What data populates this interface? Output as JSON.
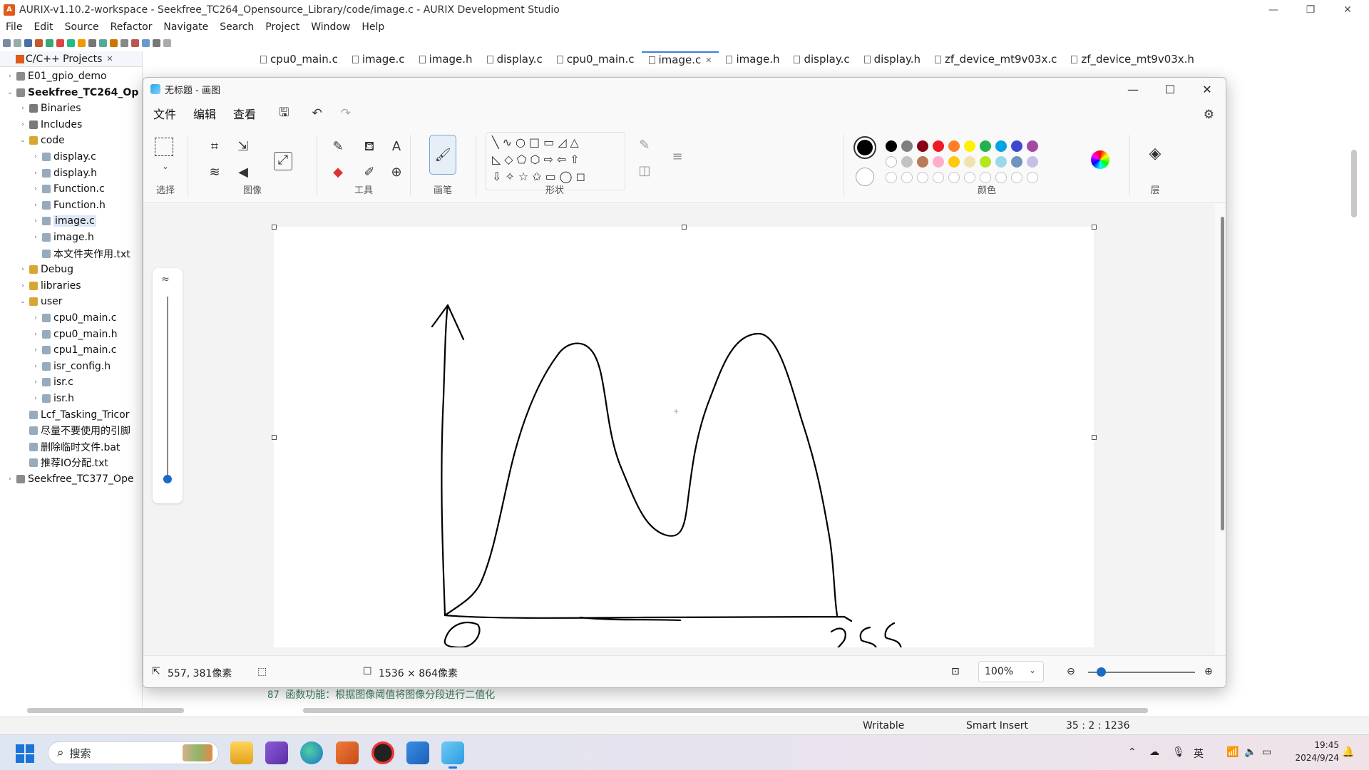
{
  "ide": {
    "title": "AURIX-v1.10.2-workspace - Seekfree_TC264_Opensource_Library/code/image.c - AURIX Development Studio",
    "menu": [
      "File",
      "Edit",
      "Source",
      "Refactor",
      "Navigate",
      "Search",
      "Project",
      "Window",
      "Help"
    ],
    "explorer_title": "C/C++ Projects",
    "tree": [
      {
        "label": "E01_gpio_demo",
        "indent": 0,
        "arrow": "›",
        "icon": "proj",
        "bold": false
      },
      {
        "label": "Seekfree_TC264_Op",
        "indent": 0,
        "arrow": "⌄",
        "icon": "proj",
        "bold": true
      },
      {
        "label": "Binaries",
        "indent": 1,
        "arrow": "›",
        "icon": "bin",
        "bold": false
      },
      {
        "label": "Includes",
        "indent": 1,
        "arrow": "›",
        "icon": "bin",
        "bold": false
      },
      {
        "label": "code",
        "indent": 1,
        "arrow": "⌄",
        "icon": "folder",
        "bold": false
      },
      {
        "label": "display.c",
        "indent": 2,
        "arrow": "›",
        "icon": "file",
        "bold": false
      },
      {
        "label": "display.h",
        "indent": 2,
        "arrow": "›",
        "icon": "file",
        "bold": false
      },
      {
        "label": "Function.c",
        "indent": 2,
        "arrow": "›",
        "icon": "file",
        "bold": false
      },
      {
        "label": "Function.h",
        "indent": 2,
        "arrow": "›",
        "icon": "file",
        "bold": false
      },
      {
        "label": "image.c",
        "indent": 2,
        "arrow": "›",
        "icon": "file",
        "bold": false,
        "selected": true
      },
      {
        "label": "image.h",
        "indent": 2,
        "arrow": "›",
        "icon": "file",
        "bold": false
      },
      {
        "label": "本文件夹作用.txt",
        "indent": 2,
        "arrow": "",
        "icon": "file",
        "bold": false
      },
      {
        "label": "Debug",
        "indent": 1,
        "arrow": "›",
        "icon": "folder",
        "bold": false
      },
      {
        "label": "libraries",
        "indent": 1,
        "arrow": "›",
        "icon": "folder",
        "bold": false
      },
      {
        "label": "user",
        "indent": 1,
        "arrow": "⌄",
        "icon": "folder",
        "bold": false
      },
      {
        "label": "cpu0_main.c",
        "indent": 2,
        "arrow": "›",
        "icon": "file",
        "bold": false
      },
      {
        "label": "cpu0_main.h",
        "indent": 2,
        "arrow": "›",
        "icon": "file",
        "bold": false
      },
      {
        "label": "cpu1_main.c",
        "indent": 2,
        "arrow": "›",
        "icon": "file",
        "bold": false
      },
      {
        "label": "isr_config.h",
        "indent": 2,
        "arrow": "›",
        "icon": "file",
        "bold": false
      },
      {
        "label": "isr.c",
        "indent": 2,
        "arrow": "›",
        "icon": "file",
        "bold": false
      },
      {
        "label": "isr.h",
        "indent": 2,
        "arrow": "›",
        "icon": "file",
        "bold": false
      },
      {
        "label": "Lcf_Tasking_Tricor",
        "indent": 1,
        "arrow": "",
        "icon": "file",
        "bold": false
      },
      {
        "label": "尽量不要使用的引脚",
        "indent": 1,
        "arrow": "",
        "icon": "file",
        "bold": false
      },
      {
        "label": "删除临时文件.bat",
        "indent": 1,
        "arrow": "",
        "icon": "file",
        "bold": false
      },
      {
        "label": "推荐IO分配.txt",
        "indent": 1,
        "arrow": "",
        "icon": "file",
        "bold": false
      },
      {
        "label": "Seekfree_TC377_Ope",
        "indent": 0,
        "arrow": "›",
        "icon": "proj",
        "bold": false
      }
    ],
    "tabs": [
      {
        "label": "cpu0_main.c",
        "active": false
      },
      {
        "label": "image.c",
        "active": false
      },
      {
        "label": "image.h",
        "active": false
      },
      {
        "label": "display.c",
        "active": false
      },
      {
        "label": "cpu0_main.c",
        "active": false
      },
      {
        "label": "image.c",
        "active": true
      },
      {
        "label": "image.h",
        "active": false
      },
      {
        "label": "display.c",
        "active": false
      },
      {
        "label": "display.h",
        "active": false
      },
      {
        "label": "zf_device_mt9v03x.c",
        "active": false
      },
      {
        "label": "zf_device_mt9v03x.h",
        "active": false
      }
    ],
    "code_line": "87  函数功能：根据图像阈值将图像分段进行二值化",
    "status": {
      "writable": "Writable",
      "insert": "Smart Insert",
      "position": "35 : 2 : 1236"
    }
  },
  "paint": {
    "title": "无标题 - 画图",
    "menu": [
      "文件",
      "编辑",
      "查看"
    ],
    "groups": {
      "select": "选择",
      "image": "图像",
      "tools": "工具",
      "brush": "画笔",
      "shapes": "形状",
      "colors": "颜色",
      "layers": "层"
    },
    "palette_row1": [
      "#000000",
      "#7f7f7f",
      "#880015",
      "#ed1c24",
      "#ff7f27",
      "#fff200",
      "#22b14c",
      "#00a2e8",
      "#3f48cc",
      "#a349a4"
    ],
    "palette_row2": [
      "#ffffff",
      "#c3c3c3",
      "#b97a57",
      "#ffaec9",
      "#ffc90e",
      "#efe4b0",
      "#b5e61d",
      "#99d9ea",
      "#7092be",
      "#c8bfe7"
    ],
    "primary_color": "#000000",
    "secondary_color": "#ffffff",
    "status": {
      "cursor": "557, 381像素",
      "size": "1536 × 864像素",
      "zoom": "100%"
    },
    "drawing_label": "255"
  },
  "taskbar": {
    "search_placeholder": "搜索",
    "ime": "英",
    "time": "19:45",
    "date": "2024/9/24"
  }
}
